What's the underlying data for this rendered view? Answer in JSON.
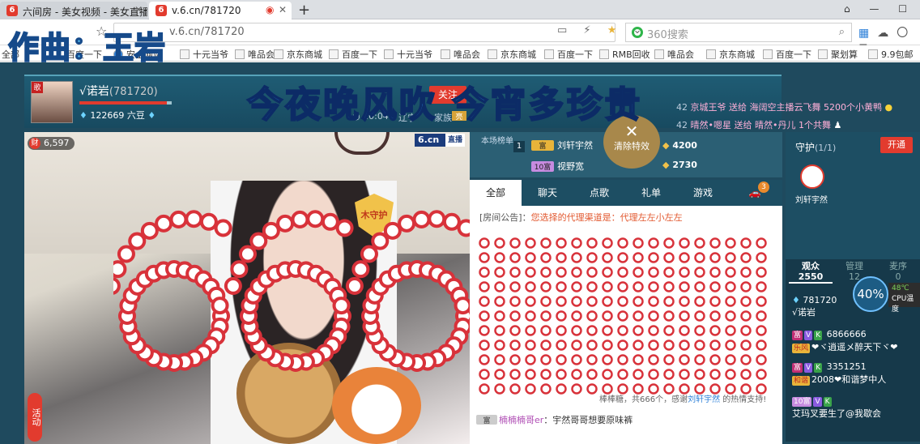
{
  "browser": {
    "tabs": [
      {
        "label": "六间房 - 美女视频 - 美女直播"
      },
      {
        "label": "v.6.cn/781720"
      }
    ],
    "url": "v.6.cn/781720",
    "search_placeholder": "360搜索",
    "bookmarks": [
      "全部",
      "百度一下",
      "安全网站",
      "十元当爷",
      "唯品会",
      "京东商城",
      "百度一下",
      "十元当爷",
      "唯品会",
      "京东商城",
      "百度一下",
      "RMB回收",
      "唯品会",
      "京东商城",
      "百度一下",
      "聚划算",
      "9.9包邮"
    ]
  },
  "overlay": {
    "watermark": "作曲：王岩",
    "title_banner": "今夜晚风吹 今宵多珍贵"
  },
  "anchor": {
    "name": "√诺岩",
    "room_id": "(781720)",
    "dou": "122669 六豆",
    "follow": "关注",
    "time": "20:04",
    "location": "辽宁",
    "family": "家族",
    "family_chip": "亮"
  },
  "gift_feed": [
    {
      "num": "42",
      "text": "京城王爷 送给 海阔空主播云飞舞 5200个小黄鸭"
    },
    {
      "num": "42",
      "text": "晴然•嗯星 送给 晴然•丹儿 1个共舞"
    }
  ],
  "video": {
    "fans": "6,597",
    "logo": "6.cn",
    "live": "直播",
    "guard_badge": "木守护",
    "activity": "活动"
  },
  "ranking": {
    "label": "本场榜单",
    "rows": [
      {
        "no": "1",
        "level": "富",
        "name": "刘轩宇然",
        "value": "4200"
      },
      {
        "no": "",
        "level": "10富",
        "name": "视野宽",
        "value": "2730"
      }
    ]
  },
  "clear_effects": "清除特效",
  "chat": {
    "tabs": [
      "全部",
      "聊天",
      "点歌",
      "礼单",
      "游戏"
    ],
    "car_badge": "3",
    "notice_key": "[房间公告]：",
    "notice": "您选择的代理渠道是：代理左左小左左",
    "thanks_prefix": "棒棒糖，共666个，感谢",
    "thanks_user": "刘轩宇然",
    "thanks_suffix": "的热情支持!",
    "line_user": "楠楠楠哥er",
    "line_text": "：宇然哥哥想要原味裤"
  },
  "guards": {
    "title": "守护",
    "count": "(1/1)",
    "open": "开通",
    "member": "刘轩宇然"
  },
  "viewers": {
    "tabs": [
      {
        "label": "观众",
        "count": "2550"
      },
      {
        "label": "管理",
        "count": "12"
      },
      {
        "label": "麦序",
        "count": "0"
      }
    ],
    "rows": [
      {
        "id": "781720",
        "name": "√诺岩"
      },
      {
        "id": "6866666",
        "name": "❤ヾ逍遥メ醉天下ヾ❤",
        "tag": "乐风"
      },
      {
        "id": "3351251",
        "name": "2008❤和谐梦中人",
        "tag": "和谐"
      },
      {
        "id": "",
        "name": "艾玛叉要生了@我歇会",
        "tag": "10富"
      }
    ]
  },
  "cpu": {
    "percent": "40%",
    "temp": "48℃",
    "label": "CPU温度"
  }
}
